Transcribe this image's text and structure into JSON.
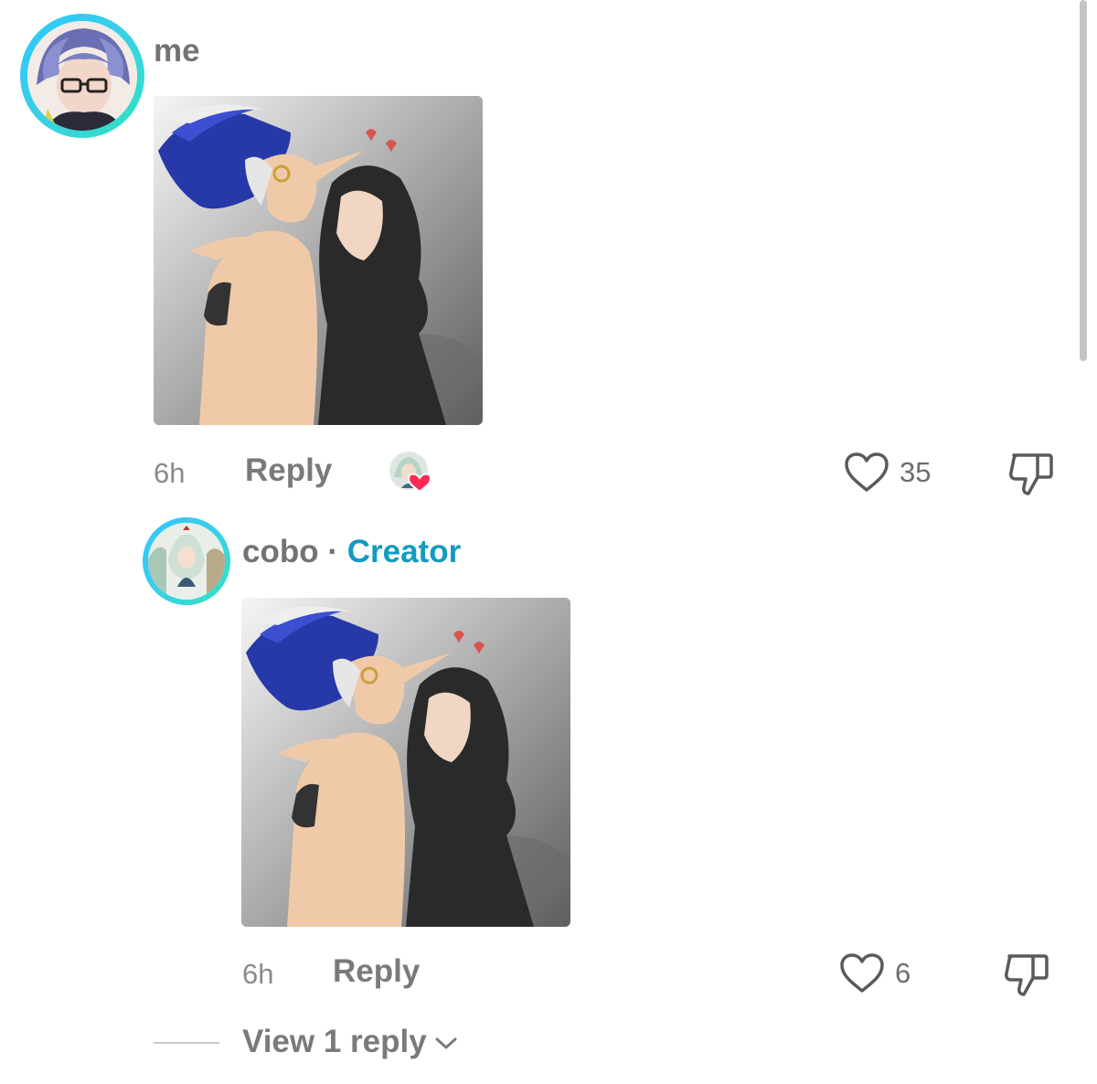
{
  "comments": [
    {
      "author": "me",
      "time": "6h",
      "reply_label": "Reply",
      "likes": "35",
      "liked_by_creator": true
    },
    {
      "author": "cobo",
      "separator": "·",
      "badge": "Creator",
      "time": "6h",
      "reply_label": "Reply",
      "likes": "6"
    }
  ],
  "view_replies_label": "View 1 reply",
  "colors": {
    "ring_gradient_start": "#2ec6ff",
    "ring_gradient_end": "#2fe3c0",
    "creator_accent": "#129bbf",
    "heart_red": "#ff2b55",
    "muted_text": "#737373"
  },
  "icons": {
    "like": "heart-outline-icon",
    "dislike": "thumbs-down-icon",
    "expand": "chevron-down-icon",
    "creator_like": "heart-filled-icon"
  }
}
